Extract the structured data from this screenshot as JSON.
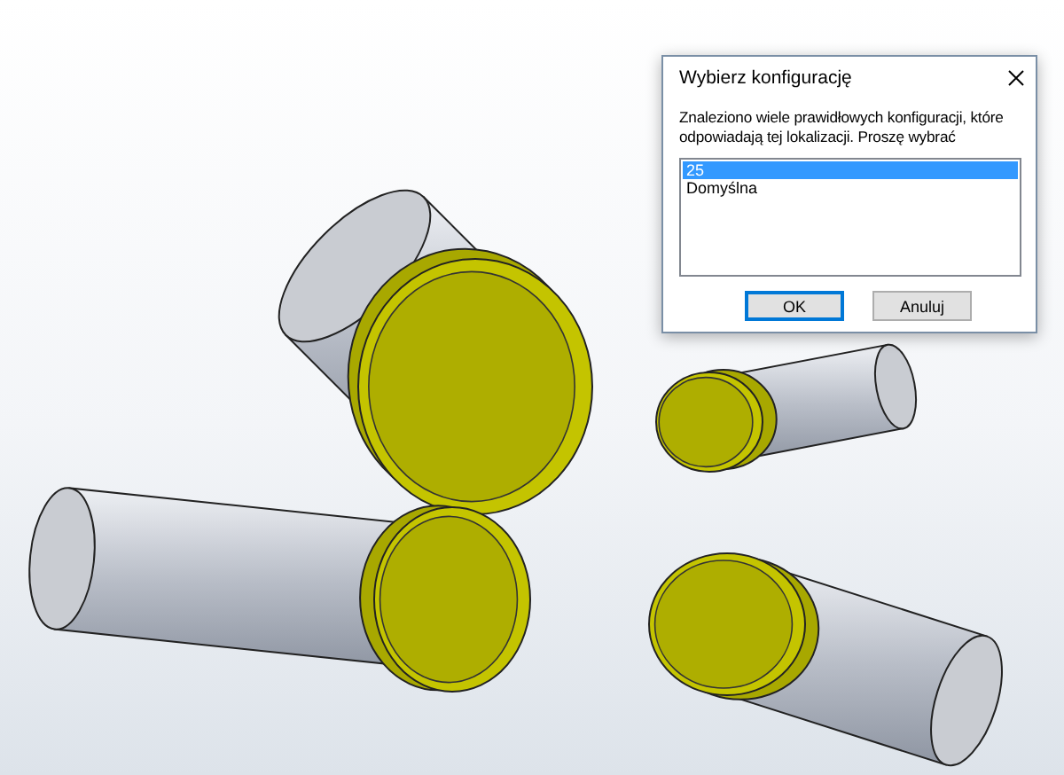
{
  "dialog": {
    "title": "Wybierz konfigurację",
    "message": "Znaleziono wiele prawidłowych konfiguracji, które odpowiadają tej lokalizacji. Proszę wybrać",
    "options": [
      {
        "label": "25",
        "selected": true
      },
      {
        "label": "Domyślna",
        "selected": false
      }
    ],
    "buttons": [
      {
        "label": "OK",
        "kind": "default"
      },
      {
        "label": "Anuluj",
        "kind": "normal"
      }
    ]
  }
}
